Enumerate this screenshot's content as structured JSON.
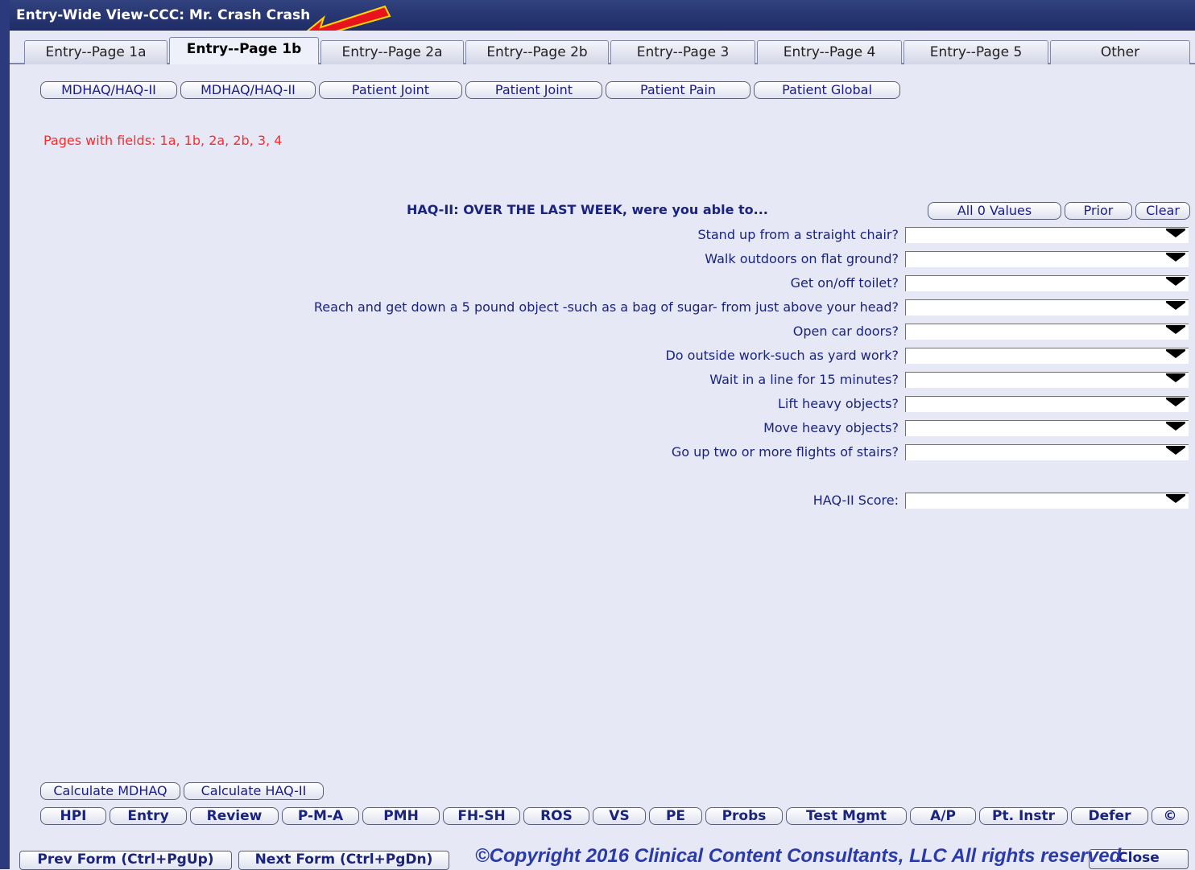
{
  "window": {
    "title": "Entry-Wide View-CCC: Mr. Crash Crash"
  },
  "tabs": [
    {
      "label": "Entry--Page 1a"
    },
    {
      "label": "Entry--Page 1b"
    },
    {
      "label": "Entry--Page 2a"
    },
    {
      "label": "Entry--Page 2b"
    },
    {
      "label": "Entry--Page 3"
    },
    {
      "label": "Entry--Page 4"
    },
    {
      "label": "Entry--Page 5"
    },
    {
      "label": "Other"
    }
  ],
  "active_tab": "Entry--Page 1b",
  "form_buttons": [
    {
      "label": "MDHAQ/HAQ-II"
    },
    {
      "label": "MDHAQ/HAQ-II"
    },
    {
      "label": "Patient Joint"
    },
    {
      "label": "Patient Joint"
    },
    {
      "label": "Patient Pain"
    },
    {
      "label": "Patient Global"
    }
  ],
  "pages_with_fields": "Pages with fields:  1a,  1b,  2a,  2b,  3,  4",
  "haq": {
    "header": "HAQ-II: OVER THE LAST WEEK, were you able to...",
    "all0_label": "All 0 Values",
    "prior_label": "Prior",
    "clear_label": "Clear",
    "questions": [
      {
        "label": "Stand up from a straight chair?",
        "value": ""
      },
      {
        "label": "Walk outdoors on flat ground?",
        "value": ""
      },
      {
        "label": "Get on/off toilet?",
        "value": ""
      },
      {
        "label": "Reach and get down a 5 pound object -such as a bag of sugar- from just above your head?",
        "value": ""
      },
      {
        "label": "Open car doors?",
        "value": ""
      },
      {
        "label": "Do outside work-such as yard work?",
        "value": ""
      },
      {
        "label": "Wait in a line for 15 minutes?",
        "value": ""
      },
      {
        "label": "Lift heavy objects?",
        "value": ""
      },
      {
        "label": "Move heavy objects?",
        "value": ""
      },
      {
        "label": "Go up two or more flights of stairs?",
        "value": ""
      }
    ],
    "score_label": "HAQ-II Score:",
    "score_value": ""
  },
  "calc": {
    "mdhaq_label": "Calculate MDHAQ",
    "haq2_label": "Calculate HAQ-II"
  },
  "nav": [
    {
      "label": "HPI"
    },
    {
      "label": "Entry"
    },
    {
      "label": "Review"
    },
    {
      "label": "P-M-A"
    },
    {
      "label": "PMH"
    },
    {
      "label": "FH-SH"
    },
    {
      "label": "ROS"
    },
    {
      "label": "VS"
    },
    {
      "label": "PE"
    },
    {
      "label": "Probs"
    },
    {
      "label": "Test Mgmt"
    },
    {
      "label": "A/P"
    },
    {
      "label": "Pt. Instr"
    },
    {
      "label": "Defer"
    },
    {
      "label": "©"
    }
  ],
  "footer": {
    "prev_label": "Prev Form (Ctrl+PgUp)",
    "next_label": "Next Form (Ctrl+PgDn)",
    "close_label": "Close",
    "copyright": "©Copyright 2016 Clinical Content Consultants, LLC All rights reserved."
  },
  "colors": {
    "title_bar": "#1f2c66",
    "background": "#e6e8f6",
    "label_text": "#1a237e",
    "warning_text": "#ff2a2a",
    "annotation_arrow": "#e8141c"
  }
}
